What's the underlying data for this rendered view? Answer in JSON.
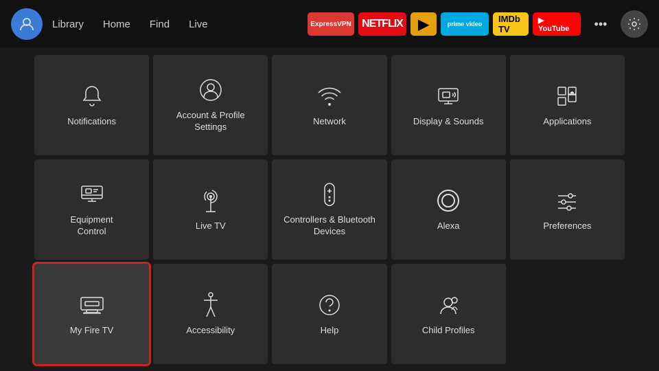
{
  "nav": {
    "links": [
      "Library",
      "Home",
      "Find",
      "Live"
    ],
    "apps": [
      {
        "name": "ExpressVPN",
        "class": "app-expressvpn",
        "label": "ExpressVPN"
      },
      {
        "name": "Netflix",
        "class": "app-netflix",
        "label": "NETFLIX"
      },
      {
        "name": "Plex",
        "class": "app-plex",
        "label": "▶"
      },
      {
        "name": "Prime Video",
        "class": "app-prime",
        "label": "prime video"
      },
      {
        "name": "IMDb TV",
        "class": "app-imdb",
        "label": "IMDb TV"
      },
      {
        "name": "YouTube",
        "class": "app-youtube",
        "label": "▶ YouTube"
      }
    ]
  },
  "grid": {
    "items": [
      {
        "id": "notifications",
        "label": "Notifications",
        "icon": "bell"
      },
      {
        "id": "account-profile",
        "label": "Account & Profile\nSettings",
        "icon": "person-circle"
      },
      {
        "id": "network",
        "label": "Network",
        "icon": "wifi"
      },
      {
        "id": "display-sounds",
        "label": "Display & Sounds",
        "icon": "display-sound"
      },
      {
        "id": "applications",
        "label": "Applications",
        "icon": "apps"
      },
      {
        "id": "equipment-control",
        "label": "Equipment\nControl",
        "icon": "monitor"
      },
      {
        "id": "live-tv",
        "label": "Live TV",
        "icon": "antenna"
      },
      {
        "id": "controllers-bluetooth",
        "label": "Controllers & Bluetooth\nDevices",
        "icon": "remote"
      },
      {
        "id": "alexa",
        "label": "Alexa",
        "icon": "alexa"
      },
      {
        "id": "preferences",
        "label": "Preferences",
        "icon": "sliders"
      },
      {
        "id": "my-fire-tv",
        "label": "My Fire TV",
        "icon": "firetv",
        "selected": true
      },
      {
        "id": "accessibility",
        "label": "Accessibility",
        "icon": "accessibility"
      },
      {
        "id": "help",
        "label": "Help",
        "icon": "help"
      },
      {
        "id": "child-profiles",
        "label": "Child Profiles",
        "icon": "child-profiles"
      }
    ]
  }
}
